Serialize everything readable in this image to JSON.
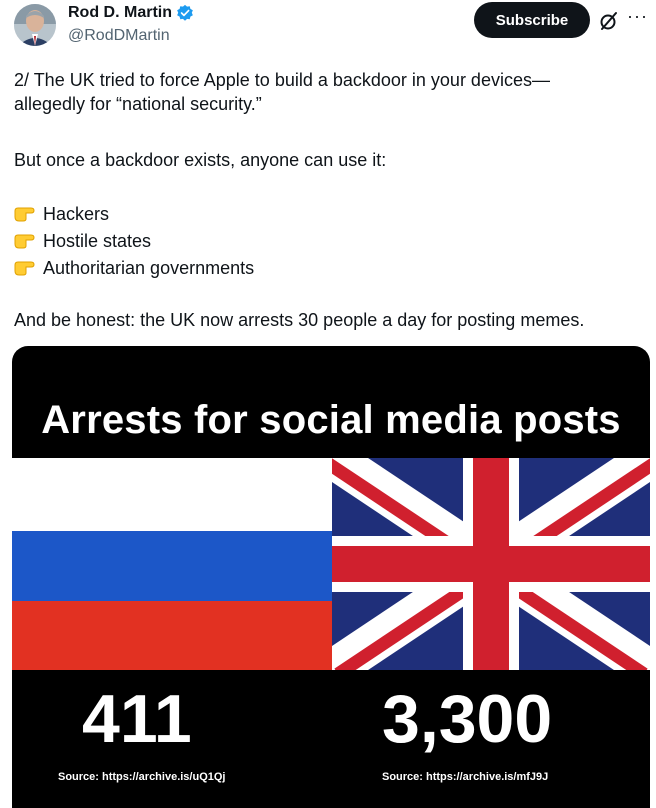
{
  "author": {
    "display_name": "Rod D. Martin",
    "handle": "@RodDMartin"
  },
  "actions": {
    "subscribe_label": "Subscribe",
    "more_label": "···"
  },
  "tweet": {
    "line1": "2/ The UK tried to force Apple to build a backdoor in your devices—",
    "line2": "allegedly for “national security.”",
    "line3": "But once a backdoor exists, anyone can use it:",
    "bullets": [
      "Hackers",
      "Hostile states",
      "Authoritarian governments"
    ],
    "line4": "And be honest: the UK now arrests 30 people a day for posting memes."
  },
  "image": {
    "title": "Arrests for social media posts",
    "left_value": "411",
    "right_value": "3,300",
    "left_source": "Source: https://archive.is/uQ1Qj",
    "right_source": "Source: https://archive.is/mfJ9J"
  },
  "colors": {
    "verified_blue": "#1d9bf0",
    "subscribe_bg": "#0f1419",
    "handle_gray": "#536471"
  }
}
